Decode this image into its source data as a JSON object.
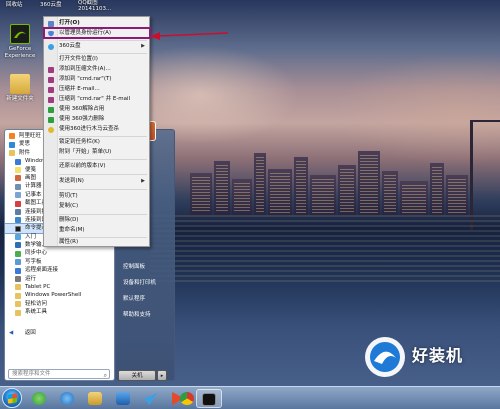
{
  "desktop": {
    "top_labels": [
      "回收站",
      "360云盘",
      "QQ截图20141103..."
    ],
    "icons": [
      {
        "label": "GeForce Experience",
        "color": "#76b900"
      },
      {
        "label": "新建文件夹",
        "color": "#e7c25e"
      }
    ]
  },
  "context_menu": {
    "items": [
      {
        "label": "打开(O)",
        "icon": "open-icon",
        "color": "#5a84c3"
      },
      {
        "label": "以管理员身份运行(A)",
        "icon": "shield-icon",
        "color": "#4b82d9"
      },
      {
        "label": "360云盘",
        "icon": "cloud-icon",
        "color": "#3aa0e6",
        "submenu": true
      },
      {
        "label": "打开文件位置(I)",
        "icon": "",
        "color": ""
      },
      {
        "label": "添加到压缩文件(A)...",
        "icon": "winrar-icon",
        "color": "#a13a7e"
      },
      {
        "label": "添加到 \"cmd.rar\"(T)",
        "icon": "winrar-icon",
        "color": "#a13a7e"
      },
      {
        "label": "压缩并 E-mail...",
        "icon": "winrar-icon",
        "color": "#a13a7e"
      },
      {
        "label": "压缩到 \"cmd.rar\" 并 E-mail",
        "icon": "winrar-icon",
        "color": "#a13a7e"
      },
      {
        "label": "使用 360解除占用",
        "icon": "360-icon",
        "color": "#2f9e3c"
      },
      {
        "label": "使用 360强力删除",
        "icon": "360-icon",
        "color": "#2f9e3c"
      },
      {
        "label": "使用360进行木马云查杀",
        "icon": "360-scan-icon",
        "color": "#e0b92d"
      },
      {
        "label": "锁定到任务栏(K)",
        "icon": "",
        "color": ""
      },
      {
        "label": "附到「开始」菜单(U)",
        "icon": "",
        "color": ""
      },
      {
        "label": "还原以前的版本(V)",
        "icon": "",
        "color": ""
      },
      {
        "label": "发送到(N)",
        "icon": "",
        "color": "",
        "submenu": true
      },
      {
        "label": "剪切(T)",
        "icon": "",
        "color": ""
      },
      {
        "label": "复制(C)",
        "icon": "",
        "color": ""
      },
      {
        "label": "删除(D)",
        "icon": "",
        "color": ""
      },
      {
        "label": "重命名(M)",
        "icon": "",
        "color": ""
      },
      {
        "label": "属性(R)",
        "icon": "",
        "color": ""
      }
    ],
    "highlight_color": "#8e1a77",
    "arrow_color": "#c8102e"
  },
  "start_menu": {
    "programs": [
      {
        "label": "阿里旺旺",
        "color": "#f58220"
      },
      {
        "label": "爱思",
        "color": "#2c8ad8"
      },
      {
        "label": "附件",
        "color": "#e7c25e"
      },
      {
        "label": "Windows",
        "color": "#3a7bd5"
      },
      {
        "label": "便笺",
        "color": "#f2e16b"
      },
      {
        "label": "画图",
        "color": "#d2663c"
      },
      {
        "label": "计算器",
        "color": "#6f8fb3"
      },
      {
        "label": "记事本",
        "color": "#7aa5d2"
      },
      {
        "label": "截图工具",
        "color": "#d54040"
      },
      {
        "label": "连接到投影",
        "color": "#5d7fa3"
      },
      {
        "label": "连接到网络",
        "color": "#3a87c9"
      },
      {
        "label": "命令提示符",
        "color": "#1a1a1a"
      },
      {
        "label": "入门",
        "color": "#58a4de"
      },
      {
        "label": "数学输入面板",
        "color": "#2f6fb8"
      },
      {
        "label": "同步中心",
        "color": "#4cae4c"
      },
      {
        "label": "写字板",
        "color": "#5b9bd5"
      },
      {
        "label": "远程桌面连接",
        "color": "#3a7bd5"
      },
      {
        "label": "运行",
        "color": "#7a7a7a"
      },
      {
        "label": "Tablet PC",
        "color": "#e7c25e"
      },
      {
        "label": "Windows PowerShell",
        "color": "#e7c25e"
      },
      {
        "label": "轻松访问",
        "color": "#e7c25e"
      },
      {
        "label": "系统工具",
        "color": "#e7c25e"
      }
    ],
    "selected_index": 11,
    "back_label": "返回",
    "search_placeholder": "搜索程序和文件",
    "right_items": [
      "控制面板",
      "设备和打印机",
      "默认程序",
      "帮助和支持"
    ],
    "shutdown_label": "关机"
  },
  "taskbar": {
    "items": [
      {
        "name": "360-browser-taskbar",
        "color": "#4caf50"
      },
      {
        "name": "ie-taskbar",
        "color": "#3d8fd6"
      },
      {
        "name": "explorer-taskbar",
        "color": "#e7c25e"
      },
      {
        "name": "network-taskbar",
        "color": "#2b6cb8"
      },
      {
        "name": "bird-taskbar",
        "color": "#3aa0e6"
      },
      {
        "name": "media-player-taskbar",
        "color": "#e24a2b"
      },
      {
        "name": "chrome-taskbar",
        "color": "#d7372c"
      },
      {
        "name": "cmd-taskbar",
        "color": "#111111"
      }
    ]
  },
  "watermark": {
    "text": "好装机"
  }
}
